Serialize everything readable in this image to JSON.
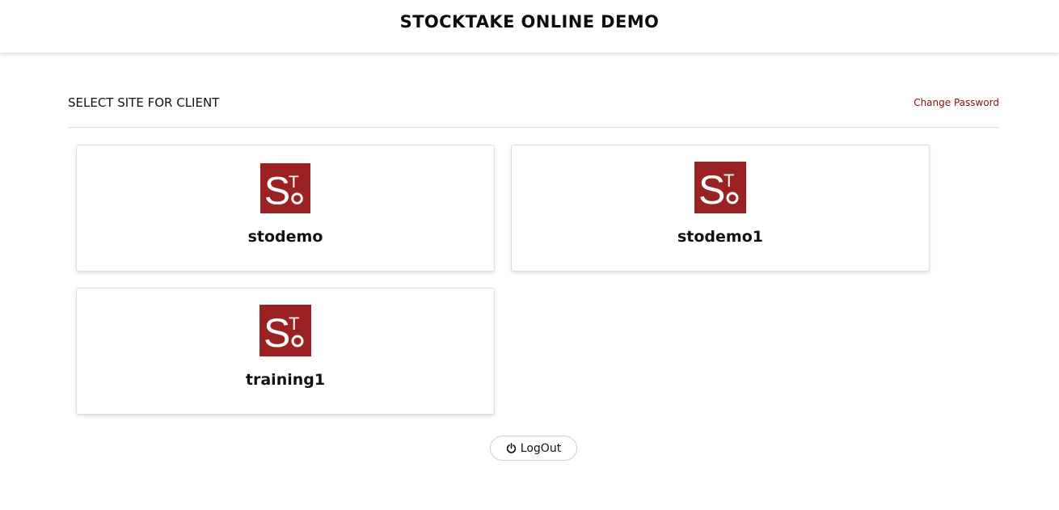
{
  "header": {
    "title": "STOCKTAKE ONLINE DEMO"
  },
  "section": {
    "title": "SELECT SITE FOR CLIENT",
    "change_password_label": "Change Password"
  },
  "sites": [
    {
      "name": "stodemo",
      "logo_icon": "sto-logo-icon"
    },
    {
      "name": "stodemo1",
      "logo_icon": "sto-logo-icon"
    },
    {
      "name": "training1",
      "logo_icon": "sto-logo-icon"
    }
  ],
  "logo": {
    "bg_color": "#9b2222",
    "fg_color": "#ffffff",
    "letters": [
      "S",
      "T",
      "O"
    ]
  },
  "logout": {
    "label": "LogOut",
    "icon": "power-icon"
  },
  "colors": {
    "accent": "#9b2222",
    "link": "#7a1212"
  }
}
